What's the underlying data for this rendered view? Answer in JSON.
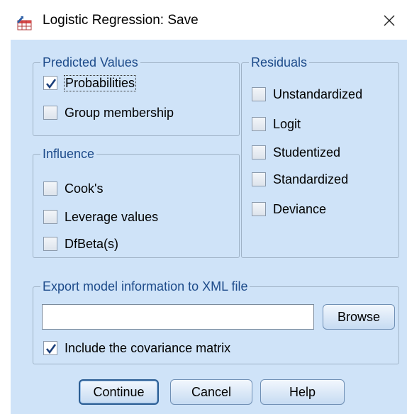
{
  "window": {
    "title": "Logistic Regression: Save",
    "close_glyph": "✕"
  },
  "predicted_values": {
    "legend": "Predicted Values",
    "probabilities": {
      "label": "Probabilities",
      "checked": true
    },
    "group_membership": {
      "label": "Group membership",
      "checked": false
    }
  },
  "influence": {
    "legend": "Influence",
    "cooks": {
      "label": "Cook's",
      "checked": false
    },
    "leverage": {
      "label": "Leverage values",
      "checked": false
    },
    "dfbeta": {
      "label": "DfBeta(s)",
      "checked": false
    }
  },
  "residuals": {
    "legend": "Residuals",
    "unstandardized": {
      "label": "Unstandardized",
      "checked": false
    },
    "logit": {
      "label": "Logit",
      "checked": false
    },
    "studentized": {
      "label": "Studentized",
      "checked": false
    },
    "standardized": {
      "label": "Standardized",
      "checked": false
    },
    "deviance": {
      "label": "Deviance",
      "checked": false
    }
  },
  "export": {
    "legend": "Export model information to XML file",
    "file_value": "",
    "browse_label": "Browse",
    "include_covariance": {
      "label": "Include the covariance matrix",
      "checked": true
    }
  },
  "buttons": {
    "continue": "Continue",
    "cancel": "Cancel",
    "help": "Help"
  },
  "colors": {
    "panel": "#cfe3f8",
    "legend_text": "#1d4b8a",
    "check_mark": "#1a3e7a"
  },
  "icons": {
    "app": "spss-dataset-icon",
    "close": "close-icon",
    "check": "checkmark-icon"
  }
}
